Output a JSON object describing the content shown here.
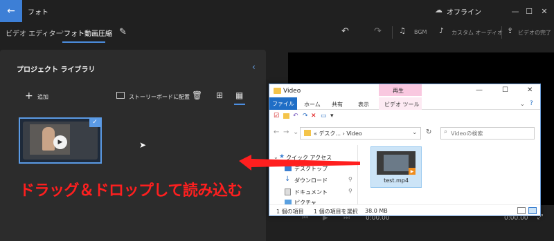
{
  "titlebar": {
    "app_title": "フォト",
    "offline_label": "オフライン",
    "back_icon": "arrow-left-icon",
    "min_icon": "minimize-icon",
    "max_icon": "maximize-icon",
    "close_icon": "close-icon"
  },
  "toolbar": {
    "breadcrumb_root": "ビデオ エディター",
    "breadcrumb_current": "フォト動画圧縮",
    "undo_icon": "undo-icon",
    "redo_icon": "redo-icon",
    "bgm_label": "BGM",
    "custom_audio_label": "カスタム オーディオ",
    "finish_label": "ビデオの完了"
  },
  "library": {
    "title": "プロジェクト ライブラリ",
    "add_label": "追加",
    "storyboard_label": "ストーリーボードに配置",
    "thumb_selected": true
  },
  "player": {
    "time_current": "0:00.00",
    "time_total": "0:00.00"
  },
  "explorer": {
    "title": "Video",
    "play_tab": "再生",
    "tabs": [
      "ファイル",
      "ホーム",
      "共有",
      "表示",
      "ビデオ ツール"
    ],
    "address": "«  デスク...  ›  Video",
    "search_placeholder": "Videoの検索",
    "nav_items": [
      "クイック アクセス",
      "デスクトップ",
      "ダウンロード",
      "ドキュメント",
      "ピクチャ"
    ],
    "file_name": "test.mp4",
    "status_count": "1 個の項目",
    "status_selected": "1 個の項目を選択",
    "status_size": "38.0 MB"
  },
  "annotation": {
    "caption": "ドラッグ＆ドロップして読み込む",
    "color": "#ff1f1f"
  },
  "colors": {
    "accent": "#4c8ee0",
    "background": "#202020",
    "panel": "#2c2c2c"
  }
}
